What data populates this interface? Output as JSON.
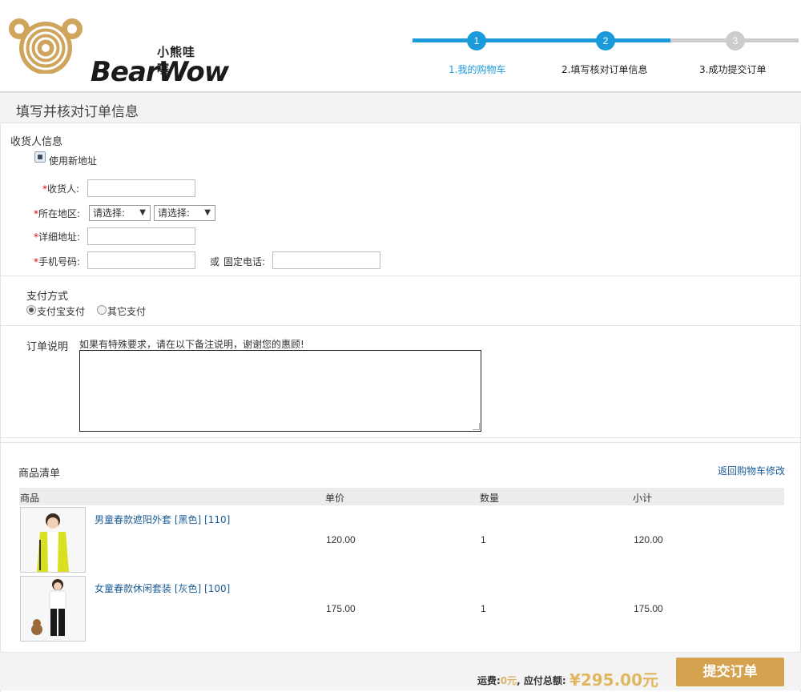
{
  "brand": {
    "name_cn": "小熊哇噻",
    "name_en": "BearWow"
  },
  "steps": [
    {
      "num": "1",
      "label": "1.我的购物车"
    },
    {
      "num": "2",
      "label": "2.填写核对订单信息"
    },
    {
      "num": "3",
      "label": "3.成功提交订单"
    }
  ],
  "page_title": "填写并核对订单信息",
  "consignee": {
    "section_label": "收货人信息",
    "use_new_address": "使用新地址",
    "required_mark": "*",
    "name_label": "收货人:",
    "region_label": "所在地区:",
    "province_select": "请选择:",
    "city_select": "请选择:",
    "address_label": "详细地址:",
    "mobile_label": "手机号码:",
    "or_text": "或",
    "phone_label": "固定电话:"
  },
  "payment": {
    "section_label": "支付方式",
    "options": [
      "支付宝支付",
      "其它支付"
    ]
  },
  "order_note": {
    "label": "订单说明",
    "hint": "如果有特殊要求，请在以下备注说明，谢谢您的惠顾!"
  },
  "products": {
    "section_label": "商品清单",
    "back_link": "返回购物车修改",
    "headers": [
      "商品",
      "单价",
      "数量",
      "小计"
    ],
    "rows": [
      {
        "name": "男童春款遮阳外套",
        "color": "[黑色]",
        "size": "[110]",
        "price": "120.00",
        "qty": "1",
        "subtotal": "120.00"
      },
      {
        "name": "女童春款休闲套装",
        "color": "[灰色]",
        "size": "[100]",
        "price": "175.00",
        "qty": "1",
        "subtotal": "175.00"
      }
    ]
  },
  "summary": {
    "shipping_label": "运费:",
    "shipping_value": "0元",
    "separator": ",",
    "total_label": "应付总额:",
    "total_value": "¥295.00元",
    "submit_label": "提交订单"
  },
  "colors": {
    "accent": "#1a9ad9",
    "submit": "#d5a24f",
    "price": "#e0b760",
    "link": "#1a5c95"
  }
}
